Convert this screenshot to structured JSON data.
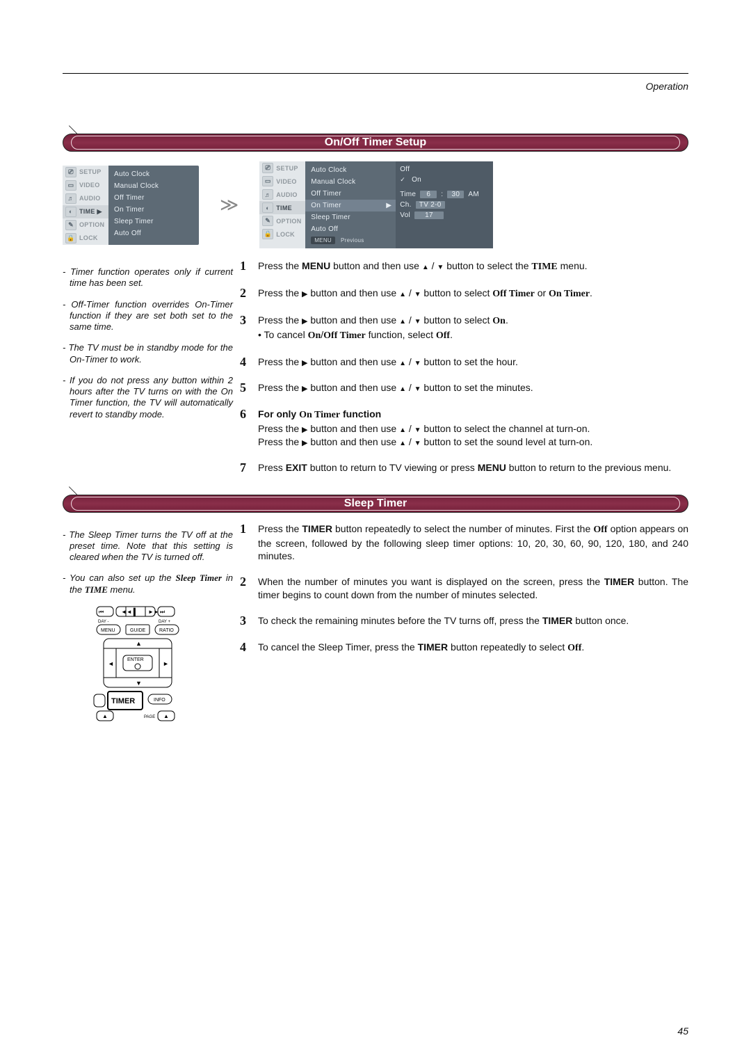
{
  "header": {
    "section_label": "Operation",
    "page_number": "45"
  },
  "section1": {
    "title": "On/Off Timer Setup"
  },
  "section2": {
    "title": "Sleep Timer"
  },
  "osd": {
    "menu_items": [
      "SETUP",
      "VIDEO",
      "AUDIO",
      "TIME",
      "OPTION",
      "LOCK"
    ],
    "active1": "TIME",
    "list_items": [
      "Auto Clock",
      "Manual Clock",
      "Off Timer",
      "On Timer",
      "Sleep Timer",
      "Auto Off"
    ],
    "selected_item": "On Timer",
    "submenu": {
      "off": "Off",
      "on": "On",
      "time_label": "Time",
      "hh": "6",
      "mm": "30",
      "ampm": "AM",
      "ch_label": "Ch.",
      "ch_val": "TV  2-0",
      "vol_label": "Vol",
      "vol_val": "17"
    },
    "footer_menu": "MENU",
    "footer_prev": "Previous"
  },
  "notes1": [
    "Timer function operates only if current time has been set.",
    "Off-Timer function overrides On-Timer function if they are set both set to the same time.",
    "The TV must be in standby mode for the On-Timer to work.",
    "If you do not press any button within 2 hours after the TV turns on with the On Timer function, the TV will automatically revert to standby mode."
  ],
  "notes2": {
    "a": "The Sleep Timer turns the TV off at the preset time. Note that this setting is cleared when the TV is turned off.",
    "b_pre": "You can also set up the ",
    "b_bold1": "Sleep Timer",
    "b_mid": " in the ",
    "b_bold2": "TIME",
    "b_post": " menu."
  },
  "steps1": {
    "1_pre": "Press the ",
    "1_b1": "MENU",
    "1_mid": " button and then use ",
    "1_post": " button to select the ",
    "1_b2": "TIME",
    "1_end": " menu.",
    "2_pre": "Press the ",
    "2_mid": " button and then use ",
    "2_post": " button to select ",
    "2_b1": "Off Timer",
    "2_or": " or ",
    "2_b2": "On Timer",
    "3_pre": "Press the ",
    "3_mid": " button and then use ",
    "3_post": " button to select ",
    "3_b1": "On",
    "3_sub_pre": "• To cancel ",
    "3_sub_b1": "On",
    "3_sub_slash": "/",
    "3_sub_b2": "Off Timer",
    "3_sub_mid": " function, select ",
    "3_sub_b3": "Off",
    "4_pre": "Press the ",
    "4_mid": " button and then use ",
    "4_post": " button to set the hour.",
    "5_pre": "Press the ",
    "5_mid": " button and then use ",
    "5_post": " button to set the minutes.",
    "6_head_pre": "For only ",
    "6_head_b": "On Timer",
    "6_head_post": " function",
    "6a_pre": "Press the ",
    "6a_mid": " button and then use ",
    "6a_post": " button to select the channel at turn-on.",
    "6b_pre": "Press the ",
    "6b_mid": " button and then use ",
    "6b_post": " button to set the sound level at turn-on.",
    "7_pre": "Press ",
    "7_b1": "EXIT",
    "7_mid": " button to return to TV viewing or press ",
    "7_b2": "MENU",
    "7_post": " button to return to the previous menu."
  },
  "steps2": {
    "1_pre": "Press the ",
    "1_b1": "TIMER",
    "1_mid": " button repeatedly to select the number of minutes. First the ",
    "1_b2": "Off",
    "1_post": " option appears on the screen, followed by the following sleep timer options: 10, 20, 30, 60, 90, 120, 180, and 240 minutes.",
    "2_pre": "When the number of minutes you want is displayed on the screen, press the ",
    "2_b1": "TIMER",
    "2_post": " button. The timer begins to count down from the number of minutes selected.",
    "3_pre": "To check the remaining minutes before the TV turns off, press the ",
    "3_b1": "TIMER",
    "3_post": " button once.",
    "4_pre": "To cancel the Sleep Timer, press the ",
    "4_b1": "TIMER",
    "4_mid": " button repeatedly to select ",
    "4_b2": "Off",
    "4_post": "."
  },
  "remote": {
    "day_minus": "DAY -",
    "day_plus": "DAY +",
    "menu": "MENU",
    "guide": "GUIDE",
    "ratio": "RATIO",
    "enter": "ENTER",
    "timer": "TIMER",
    "info": "INFO",
    "page": "PAGE"
  }
}
